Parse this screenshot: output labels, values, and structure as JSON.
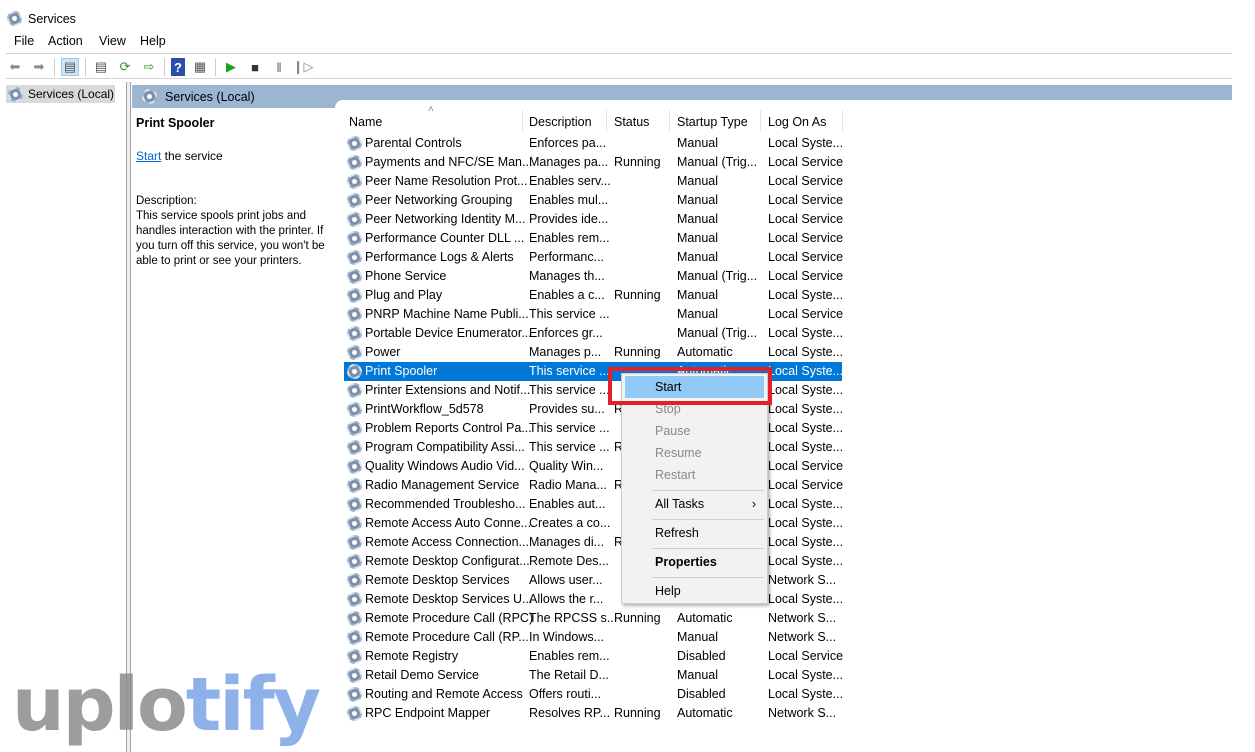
{
  "window": {
    "title": "Services",
    "icon": "services-gear-icon"
  },
  "menu": [
    "File",
    "Action",
    "View",
    "Help"
  ],
  "toolbar": [
    "back-arrow-icon",
    "forward-arrow-icon",
    "console-tree-icon",
    "properties-icon",
    "refresh-icon",
    "export-icon",
    "help-icon",
    "action-pane-icon",
    "play-icon",
    "stop-icon",
    "pause-icon",
    "resume-icon"
  ],
  "tree": {
    "item": "Services (Local)"
  },
  "header": {
    "title": "Services (Local)"
  },
  "details": {
    "title": "Print Spooler",
    "start_link": "Start",
    "start_rest": " the service",
    "desc_label": "Description:",
    "desc_text": "This service spools print jobs and handles interaction with the printer. If you turn off this service, you won't be able to print or see your printers."
  },
  "columns": {
    "name": "Name",
    "description": "Description",
    "status": "Status",
    "startup": "Startup Type",
    "logon": "Log On As"
  },
  "rows": [
    [
      "Parental Controls",
      "Enforces pa...",
      "",
      "Manual",
      "Local Syste..."
    ],
    [
      "Payments and NFC/SE Man...",
      "Manages pa...",
      "Running",
      "Manual (Trig...",
      "Local Service"
    ],
    [
      "Peer Name Resolution Prot...",
      "Enables serv...",
      "",
      "Manual",
      "Local Service"
    ],
    [
      "Peer Networking Grouping",
      "Enables mul...",
      "",
      "Manual",
      "Local Service"
    ],
    [
      "Peer Networking Identity M...",
      "Provides ide...",
      "",
      "Manual",
      "Local Service"
    ],
    [
      "Performance Counter DLL ...",
      "Enables rem...",
      "",
      "Manual",
      "Local Service"
    ],
    [
      "Performance Logs & Alerts",
      "Performanc...",
      "",
      "Manual",
      "Local Service"
    ],
    [
      "Phone Service",
      "Manages th...",
      "",
      "Manual (Trig...",
      "Local Service"
    ],
    [
      "Plug and Play",
      "Enables a c...",
      "Running",
      "Manual",
      "Local Syste..."
    ],
    [
      "PNRP Machine Name Publi...",
      "This service ...",
      "",
      "Manual",
      "Local Service"
    ],
    [
      "Portable Device Enumerator...",
      "Enforces gr...",
      "",
      "Manual (Trig...",
      "Local Syste..."
    ],
    [
      "Power",
      "Manages p...",
      "Running",
      "Automatic",
      "Local Syste..."
    ],
    [
      "Print Spooler",
      "This service ...",
      "",
      "Automatic",
      "Local Syste..."
    ],
    [
      "Printer Extensions and Notif...",
      "This service ...",
      "",
      "",
      "Local Syste..."
    ],
    [
      "PrintWorkflow_5d578",
      "Provides su...",
      "R",
      "",
      "Local Syste..."
    ],
    [
      "Problem Reports Control Pa...",
      "This service ...",
      "",
      "",
      "Local Syste..."
    ],
    [
      "Program Compatibility Assi...",
      "This service ...",
      "R",
      "",
      "Local Syste..."
    ],
    [
      "Quality Windows Audio Vid...",
      "Quality Win...",
      "",
      "",
      "Local Service"
    ],
    [
      "Radio Management Service",
      "Radio Mana...",
      "R",
      "",
      "Local Service"
    ],
    [
      "Recommended Troublesho...",
      "Enables aut...",
      "",
      "",
      "Local Syste..."
    ],
    [
      "Remote Access Auto Conne...",
      "Creates a co...",
      "",
      "",
      "Local Syste..."
    ],
    [
      "Remote Access Connection...",
      "Manages di...",
      "R",
      "",
      "Local Syste..."
    ],
    [
      "Remote Desktop Configurat...",
      "Remote Des...",
      "",
      "",
      "Local Syste..."
    ],
    [
      "Remote Desktop Services",
      "Allows user...",
      "",
      "",
      "Network S..."
    ],
    [
      "Remote Desktop Services U...",
      "Allows the r...",
      "",
      "",
      "Local Syste..."
    ],
    [
      "Remote Procedure Call (RPC)",
      "The RPCSS s...",
      "Running",
      "Automatic",
      "Network S..."
    ],
    [
      "Remote Procedure Call (RP...",
      "In Windows...",
      "",
      "Manual",
      "Network S..."
    ],
    [
      "Remote Registry",
      "Enables rem...",
      "",
      "Disabled",
      "Local Service"
    ],
    [
      "Retail Demo Service",
      "The Retail D...",
      "",
      "Manual",
      "Local Syste..."
    ],
    [
      "Routing and Remote Access",
      "Offers routi...",
      "",
      "Disabled",
      "Local Syste..."
    ],
    [
      "RPC Endpoint Mapper",
      "Resolves RP...",
      "Running",
      "Automatic",
      "Network S..."
    ]
  ],
  "selected_row": "Print Spooler",
  "context_menu": {
    "start": "Start",
    "stop": "Stop",
    "pause": "Pause",
    "resume": "Resume",
    "restart": "Restart",
    "all_tasks": "All Tasks",
    "all_tasks_arrow": "›",
    "refresh": "Refresh",
    "properties": "Properties",
    "help": "Help"
  },
  "colors": {
    "selection": "#0078d7",
    "menu_highlight": "#91c9f7",
    "header_bar": "#9cb5d1",
    "highlight_box": "#e0202a"
  },
  "watermark": {
    "part1": "uplo",
    "part2": "tify"
  }
}
